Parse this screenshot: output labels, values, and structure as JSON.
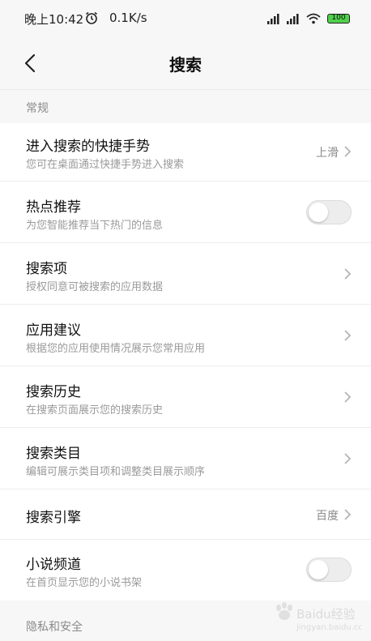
{
  "status_bar": {
    "time": "晚上10:42",
    "speed": "0.1K/s",
    "battery": "100"
  },
  "header": {
    "title": "搜索"
  },
  "sections": {
    "general": "常规",
    "privacy": "隐私和安全"
  },
  "rows": [
    {
      "title": "进入搜索的快捷手势",
      "subtitle": "您可在桌面通过快捷手势进入搜索",
      "value": "上滑"
    },
    {
      "title": "热点推荐",
      "subtitle": "为您智能推荐当下热门的信息",
      "toggle_on": false
    },
    {
      "title": "搜索项",
      "subtitle": "授权同意可被搜索的应用数据"
    },
    {
      "title": "应用建议",
      "subtitle": "根据您的应用使用情况展示您常用应用"
    },
    {
      "title": "搜索历史",
      "subtitle": "在搜索页面展示您的搜索历史"
    },
    {
      "title": "搜索类目",
      "subtitle": "编辑可展示类目项和调整类目展示顺序"
    },
    {
      "title": "搜索引擎",
      "value": "百度"
    },
    {
      "title": "小说频道",
      "subtitle": "在首页显示您的小说书架",
      "toggle_on": false
    }
  ],
  "watermark": {
    "text": "Baidu经验",
    "url": "jingyan.baidu.com"
  }
}
